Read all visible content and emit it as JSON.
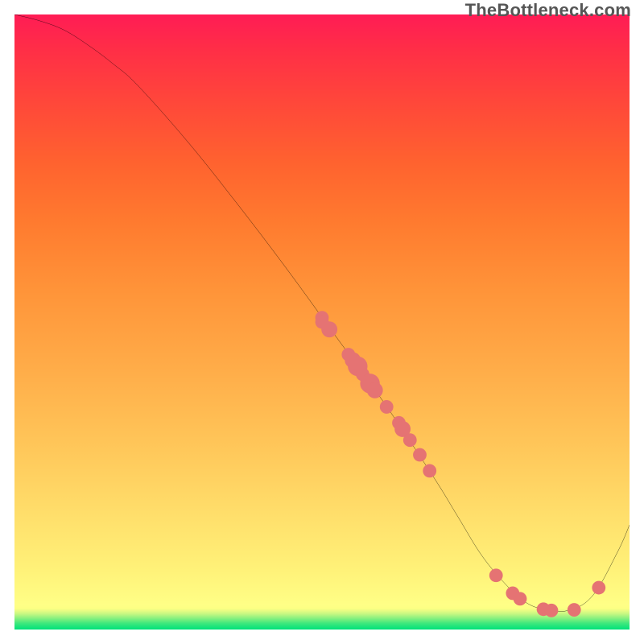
{
  "watermark": "TheBottleneck.com",
  "chart_data": {
    "type": "line",
    "title": "",
    "xlabel": "",
    "ylabel": "",
    "xlim": [
      0,
      100
    ],
    "ylim": [
      0,
      100
    ],
    "series": [
      {
        "name": "curve",
        "x": [
          0,
          4,
          8,
          12,
          16,
          20,
          28,
          36,
          44,
          52,
          60,
          68,
          72,
          76,
          80,
          83,
          86,
          90,
          94,
          98,
          100
        ],
        "y": [
          100,
          99,
          97.5,
          95,
          92,
          88.5,
          79.5,
          69.5,
          59,
          48,
          37,
          25,
          18.5,
          12,
          7.2,
          4.5,
          3.3,
          3.1,
          5.5,
          12.5,
          17
        ]
      }
    ],
    "markers": [
      {
        "x": 50.0,
        "y": 50.7,
        "r": 1.1
      },
      {
        "x": 50.0,
        "y": 50.0,
        "r": 1.1
      },
      {
        "x": 51.2,
        "y": 48.8,
        "r": 1.3
      },
      {
        "x": 54.3,
        "y": 44.7,
        "r": 1.1
      },
      {
        "x": 55.0,
        "y": 43.8,
        "r": 1.3
      },
      {
        "x": 55.8,
        "y": 42.8,
        "r": 1.6
      },
      {
        "x": 56.6,
        "y": 41.5,
        "r": 1.1
      },
      {
        "x": 57.8,
        "y": 40.0,
        "r": 1.6
      },
      {
        "x": 58.6,
        "y": 38.9,
        "r": 1.3
      },
      {
        "x": 60.5,
        "y": 36.2,
        "r": 1.1
      },
      {
        "x": 62.5,
        "y": 33.6,
        "r": 1.1
      },
      {
        "x": 63.1,
        "y": 32.6,
        "r": 1.3
      },
      {
        "x": 64.3,
        "y": 30.8,
        "r": 1.1
      },
      {
        "x": 65.9,
        "y": 28.4,
        "r": 1.1
      },
      {
        "x": 67.5,
        "y": 25.8,
        "r": 1.1
      },
      {
        "x": 78.3,
        "y": 8.8,
        "r": 1.1
      },
      {
        "x": 81.0,
        "y": 5.9,
        "r": 1.1
      },
      {
        "x": 82.2,
        "y": 5.0,
        "r": 1.1
      },
      {
        "x": 86.0,
        "y": 3.3,
        "r": 1.1
      },
      {
        "x": 87.3,
        "y": 3.1,
        "r": 1.1
      },
      {
        "x": 91.0,
        "y": 3.2,
        "r": 1.1
      },
      {
        "x": 95.0,
        "y": 6.8,
        "r": 1.1
      }
    ],
    "colors": {
      "curve_stroke": "#000000",
      "marker_fill": "#e57373"
    }
  }
}
